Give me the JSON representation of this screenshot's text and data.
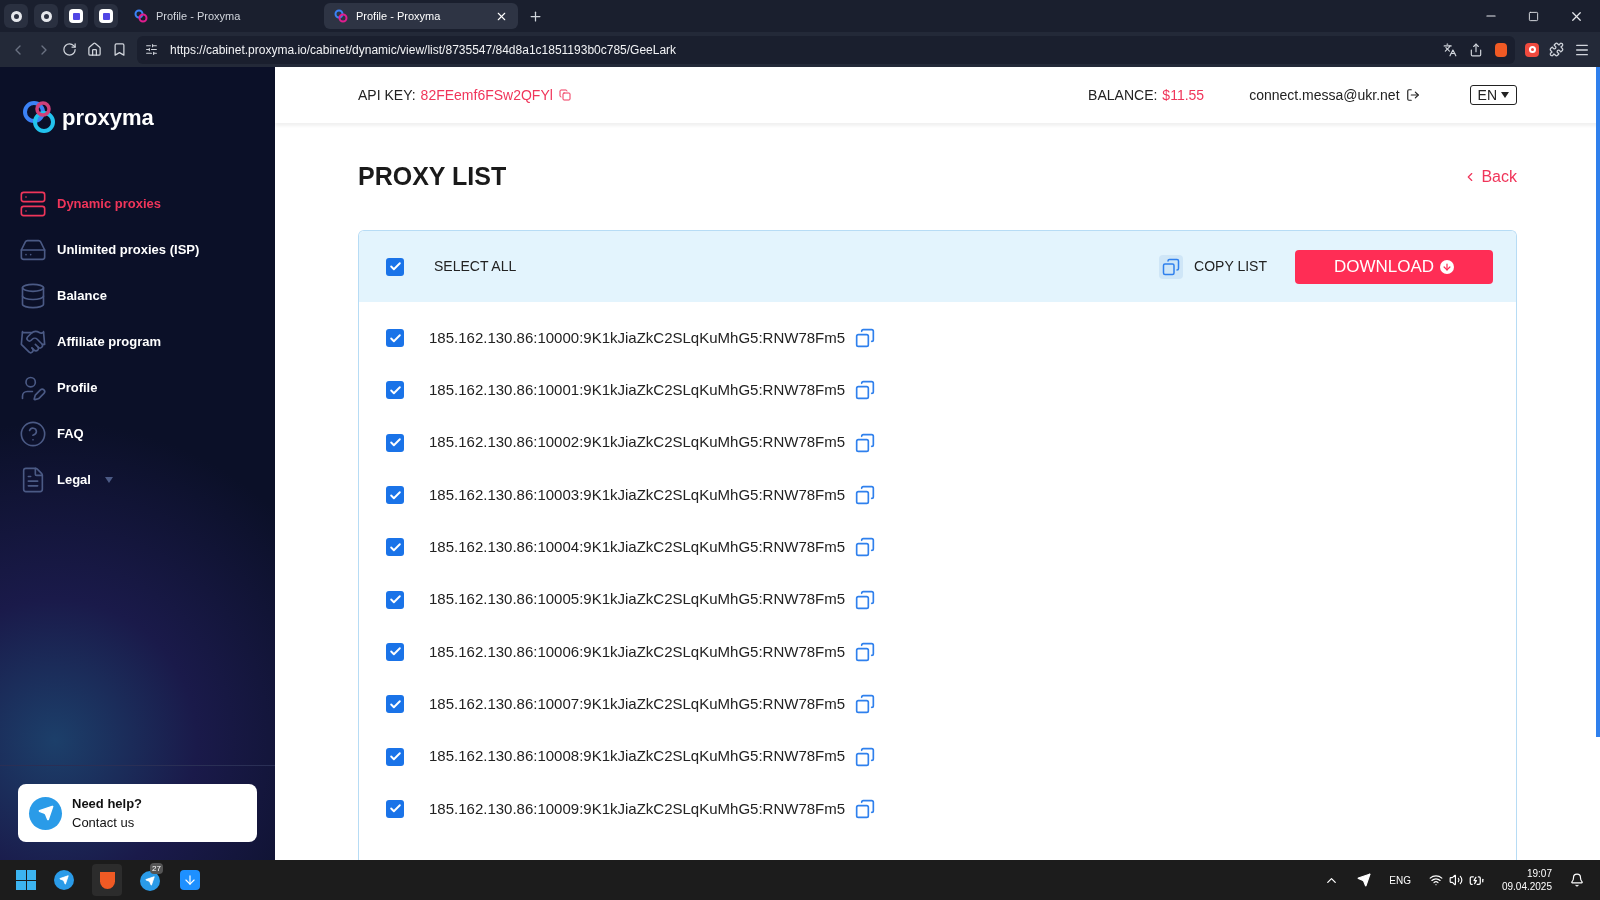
{
  "browser": {
    "tabs": [
      {
        "title": "Profile - Proxyma",
        "selected": false
      },
      {
        "title": "Profile - Proxyma",
        "selected": true
      }
    ],
    "url": "https://cabinet.proxyma.io/cabinet/dynamic/view/list/8735547/84d8a1c1851193b0c785/GeeLark"
  },
  "sidebar": {
    "logo": "proxyma",
    "items": [
      {
        "label": "Dynamic proxies",
        "selected": true,
        "has_caret": false
      },
      {
        "label": "Unlimited proxies (ISP)",
        "selected": false,
        "has_caret": false
      },
      {
        "label": "Balance",
        "selected": false,
        "has_caret": false
      },
      {
        "label": "Affiliate program",
        "selected": false,
        "has_caret": false
      },
      {
        "label": "Profile",
        "selected": false,
        "has_caret": false
      },
      {
        "label": "FAQ",
        "selected": false,
        "has_caret": false
      },
      {
        "label": "Legal",
        "selected": false,
        "has_caret": true
      }
    ],
    "help": {
      "title": "Need help?",
      "link": "Contact us"
    }
  },
  "header": {
    "api_key_label": "API KEY:",
    "api_key": "82FEemf6FSw2QFYl",
    "balance_label": "BALANCE:",
    "balance": "$11.55",
    "email": "connect.messa@ukr.net",
    "language": "EN"
  },
  "page": {
    "title": "PROXY LIST",
    "back": "Back"
  },
  "list": {
    "select_all": {
      "label": "SELECT ALL",
      "checked": true
    },
    "copy_list": "COPY LIST",
    "download": "DOWNLOAD",
    "rows": [
      {
        "text": "185.162.130.86:10000:9K1kJiaZkC2SLqKuMhG5:RNW78Fm5",
        "checked": true
      },
      {
        "text": "185.162.130.86:10001:9K1kJiaZkC2SLqKuMhG5:RNW78Fm5",
        "checked": true
      },
      {
        "text": "185.162.130.86:10002:9K1kJiaZkC2SLqKuMhG5:RNW78Fm5",
        "checked": true
      },
      {
        "text": "185.162.130.86:10003:9K1kJiaZkC2SLqKuMhG5:RNW78Fm5",
        "checked": true
      },
      {
        "text": "185.162.130.86:10004:9K1kJiaZkC2SLqKuMhG5:RNW78Fm5",
        "checked": true
      },
      {
        "text": "185.162.130.86:10005:9K1kJiaZkC2SLqKuMhG5:RNW78Fm5",
        "checked": true
      },
      {
        "text": "185.162.130.86:10006:9K1kJiaZkC2SLqKuMhG5:RNW78Fm5",
        "checked": true
      },
      {
        "text": "185.162.130.86:10007:9K1kJiaZkC2SLqKuMhG5:RNW78Fm5",
        "checked": true
      },
      {
        "text": "185.162.130.86:10008:9K1kJiaZkC2SLqKuMhG5:RNW78Fm5",
        "checked": true
      },
      {
        "text": "185.162.130.86:10009:9K1kJiaZkC2SLqKuMhG5:RNW78Fm5",
        "checked": true
      }
    ]
  },
  "taskbar": {
    "badge": "27",
    "language": "ENG",
    "time": "19:07",
    "date": "09.04.2025"
  }
}
